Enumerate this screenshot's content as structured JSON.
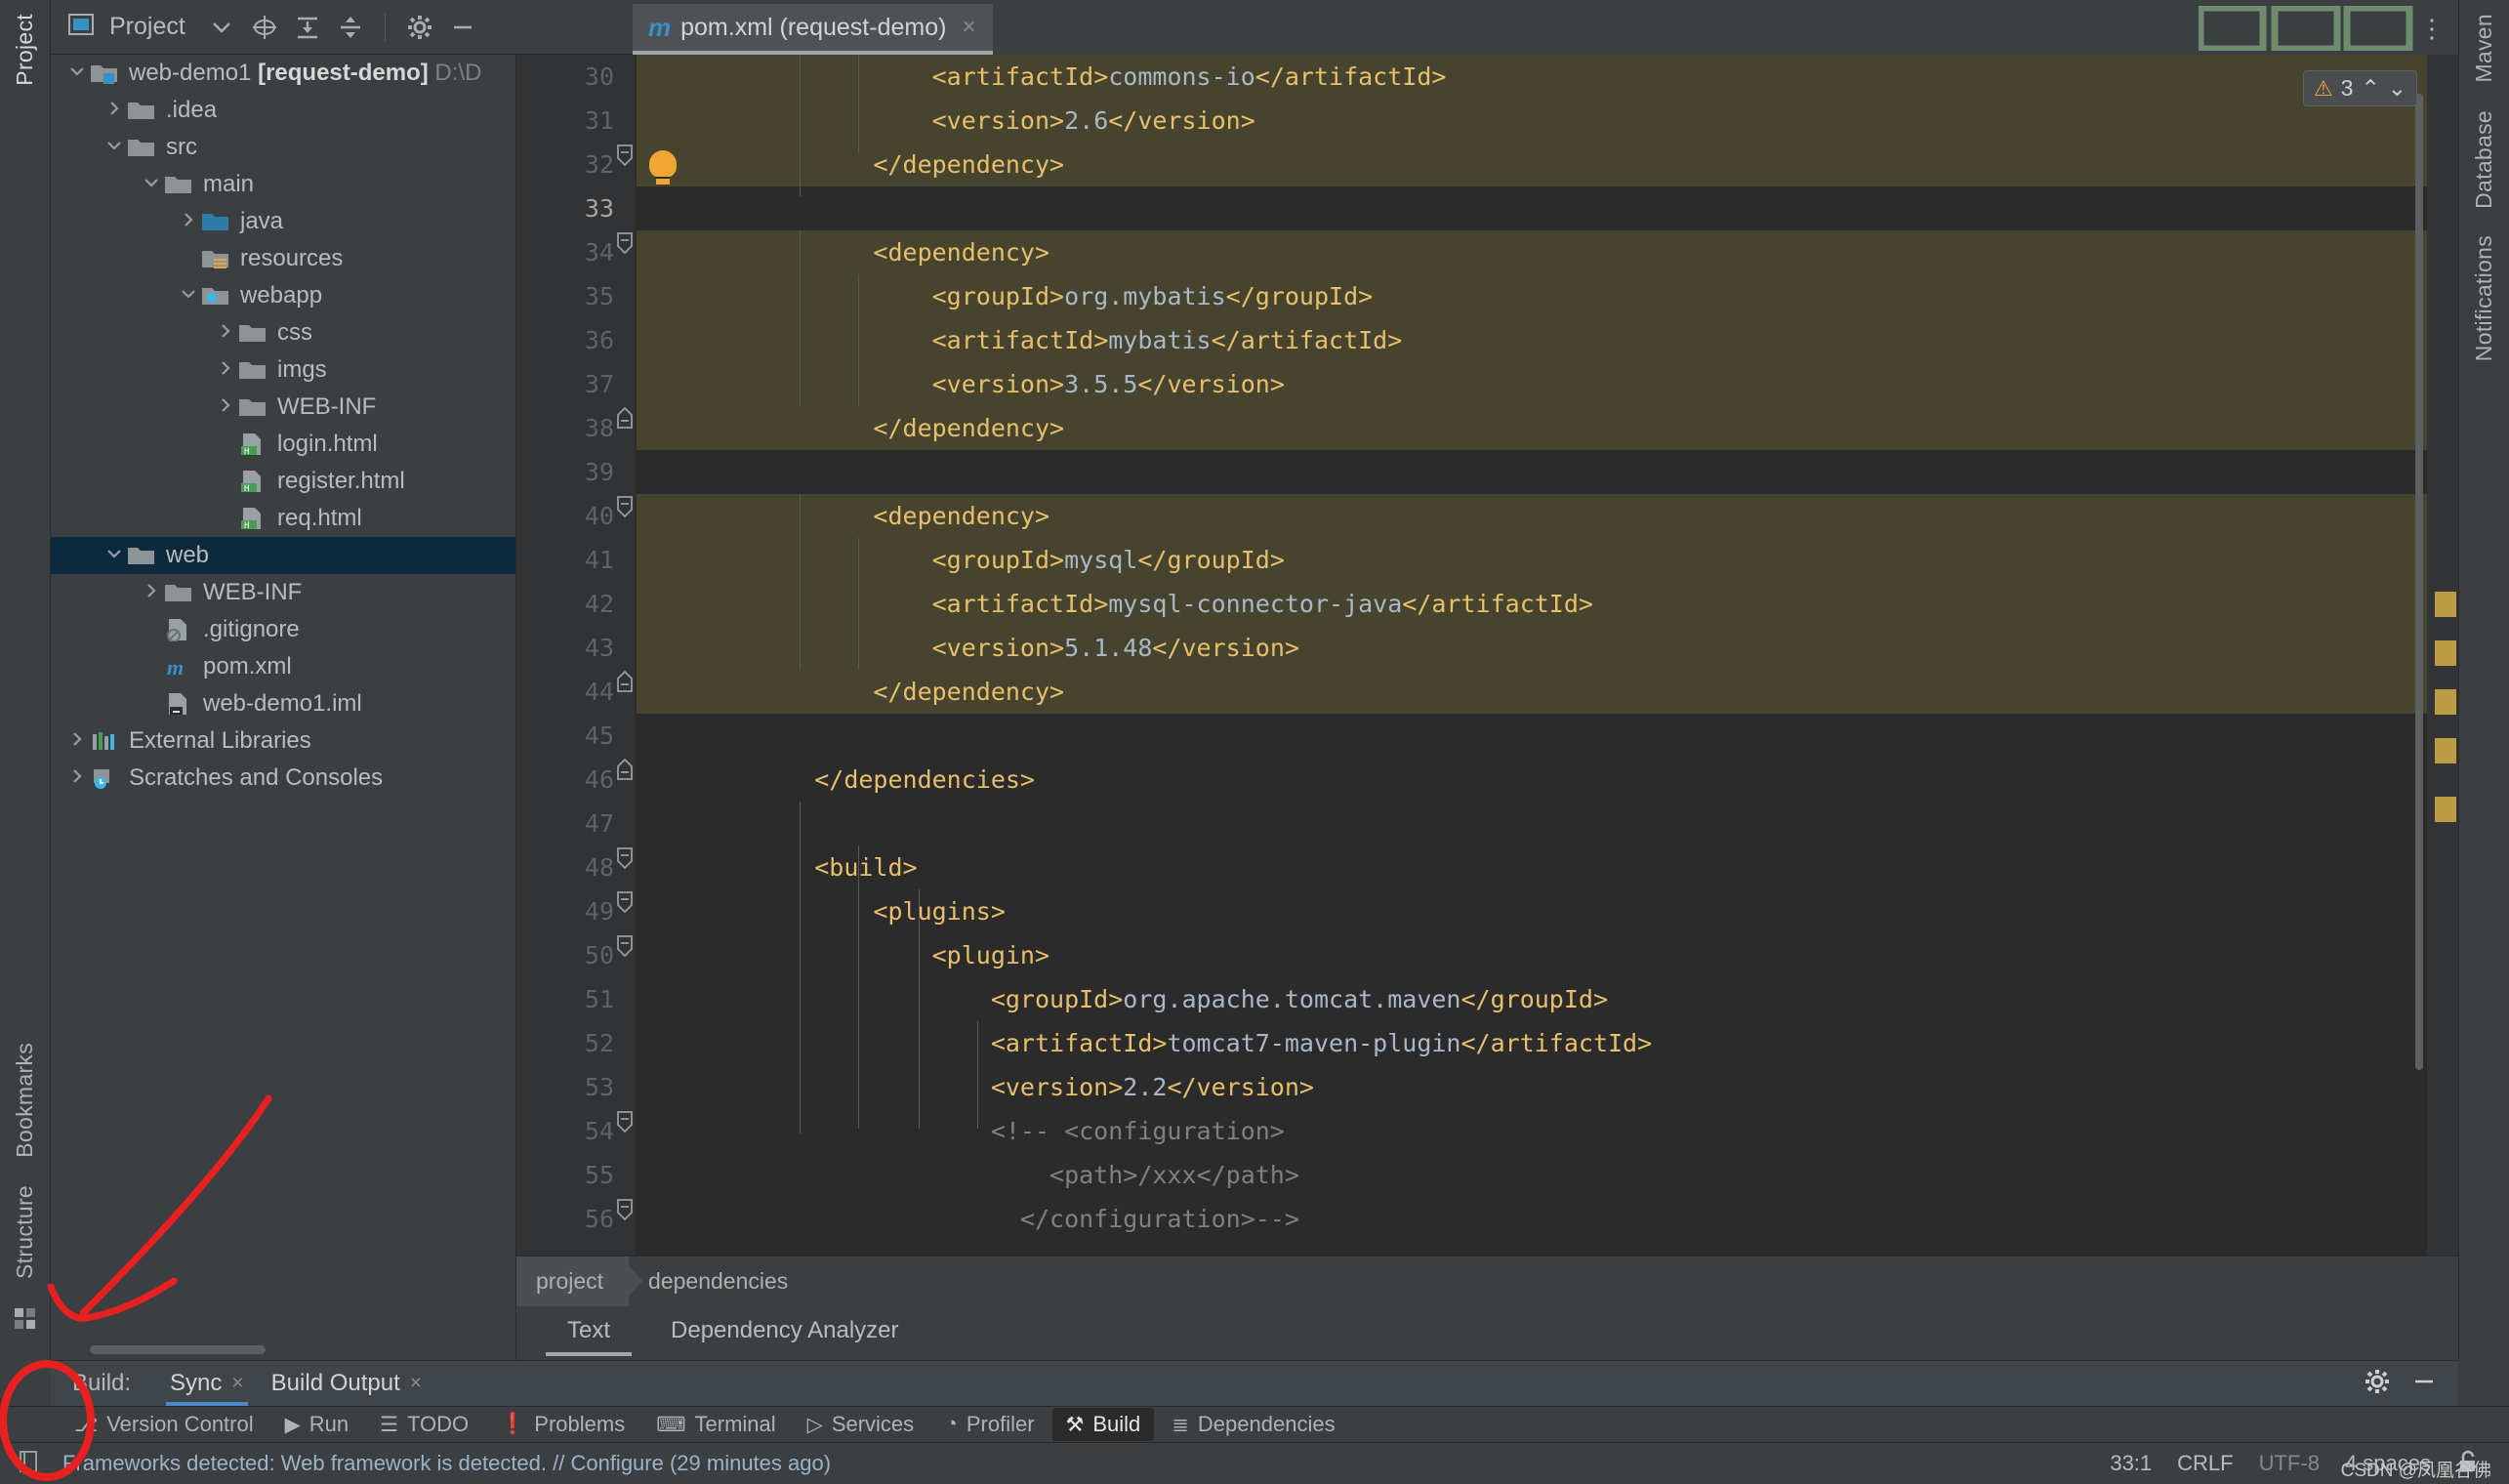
{
  "window": {
    "left_tool_tabs": [
      "Project",
      "Bookmarks",
      "Structure"
    ],
    "right_tool_tabs": [
      "Maven",
      "Database",
      "Notifications"
    ]
  },
  "project_toolbar": {
    "title": "Project",
    "dropdown_icon": "chevron-down-icon",
    "buttons": [
      {
        "name": "locate-icon",
        "glyph": "⊕"
      },
      {
        "name": "expand-all-icon",
        "glyph": "≡"
      },
      {
        "name": "collapse-all-icon",
        "glyph": "≡"
      },
      {
        "name": "settings-gear-icon",
        "glyph": "⚙"
      },
      {
        "name": "hide-panel-icon",
        "glyph": "—"
      }
    ]
  },
  "editor_tabs": [
    {
      "label": "pom.xml (request-demo)",
      "icon": "maven-m-icon",
      "close": "×",
      "active": true
    }
  ],
  "tree": [
    {
      "depth": 0,
      "arrow": "down",
      "icon": "module-folder",
      "label": "web-demo1 ",
      "bold": "[request-demo]",
      "dim": " D:\\D",
      "selected": false
    },
    {
      "depth": 1,
      "arrow": "right",
      "icon": "folder",
      "label": ".idea",
      "selected": false
    },
    {
      "depth": 1,
      "arrow": "down",
      "icon": "folder",
      "label": "src",
      "selected": false
    },
    {
      "depth": 2,
      "arrow": "down",
      "icon": "folder",
      "label": "main",
      "selected": false
    },
    {
      "depth": 3,
      "arrow": "right",
      "icon": "source-folder",
      "label": "java",
      "selected": false
    },
    {
      "depth": 3,
      "arrow": "blank",
      "icon": "resource-folder",
      "label": "resources",
      "selected": false
    },
    {
      "depth": 3,
      "arrow": "down",
      "icon": "webapp-folder",
      "label": "webapp",
      "selected": false
    },
    {
      "depth": 4,
      "arrow": "right",
      "icon": "folder",
      "label": "css",
      "selected": false
    },
    {
      "depth": 4,
      "arrow": "right",
      "icon": "folder",
      "label": "imgs",
      "selected": false
    },
    {
      "depth": 4,
      "arrow": "right",
      "icon": "folder",
      "label": "WEB-INF",
      "selected": false
    },
    {
      "depth": 4,
      "arrow": "blank",
      "icon": "html-file",
      "label": "login.html",
      "selected": false
    },
    {
      "depth": 4,
      "arrow": "blank",
      "icon": "html-file",
      "label": "register.html",
      "selected": false
    },
    {
      "depth": 4,
      "arrow": "blank",
      "icon": "html-file",
      "label": "req.html",
      "selected": false
    },
    {
      "depth": 1,
      "arrow": "down",
      "icon": "folder",
      "label": "web",
      "selected": true
    },
    {
      "depth": 2,
      "arrow": "right",
      "icon": "folder",
      "label": "WEB-INF",
      "selected": false
    },
    {
      "depth": 2,
      "arrow": "blank",
      "icon": "gitignore-file",
      "label": ".gitignore",
      "selected": false
    },
    {
      "depth": 2,
      "arrow": "blank",
      "icon": "maven-m-icon",
      "label": "pom.xml",
      "selected": false
    },
    {
      "depth": 2,
      "arrow": "blank",
      "icon": "iml-file",
      "label": "web-demo1.iml",
      "selected": false
    },
    {
      "depth": 0,
      "arrow": "right",
      "icon": "libraries-icon",
      "label": "External Libraries",
      "selected": false
    },
    {
      "depth": 0,
      "arrow": "right",
      "icon": "scratches-icon",
      "label": "Scratches and Consoles",
      "selected": false
    }
  ],
  "code": {
    "language": "xml",
    "lines": [
      {
        "n": 30,
        "text": "            <artifactId>commons-io</artifactId>",
        "hl": true,
        "fold": "",
        "bulb": false
      },
      {
        "n": 31,
        "text": "            <version>2.6</version>",
        "hl": true,
        "fold": "",
        "bulb": false
      },
      {
        "n": 32,
        "text": "        </dependency>",
        "hl": true,
        "fold": "minus",
        "bulb": true
      },
      {
        "n": 33,
        "text": "",
        "hl": false,
        "fold": "",
        "bulb": false,
        "current": true
      },
      {
        "n": 34,
        "text": "        <dependency>",
        "hl": true,
        "fold": "minus",
        "bulb": false
      },
      {
        "n": 35,
        "text": "            <groupId>org.mybatis</groupId>",
        "hl": true,
        "fold": "",
        "bulb": false
      },
      {
        "n": 36,
        "text": "            <artifactId>mybatis</artifactId>",
        "hl": true,
        "fold": "",
        "bulb": false
      },
      {
        "n": 37,
        "text": "            <version>3.5.5</version>",
        "hl": true,
        "fold": "",
        "bulb": false
      },
      {
        "n": 38,
        "text": "        </dependency>",
        "hl": true,
        "fold": "up",
        "bulb": false
      },
      {
        "n": 39,
        "text": "",
        "hl": false,
        "fold": "",
        "bulb": false
      },
      {
        "n": 40,
        "text": "        <dependency>",
        "hl": true,
        "fold": "minus",
        "bulb": false
      },
      {
        "n": 41,
        "text": "            <groupId>mysql</groupId>",
        "hl": true,
        "fold": "",
        "bulb": false
      },
      {
        "n": 42,
        "text": "            <artifactId>mysql-connector-java</artifactId>",
        "hl": true,
        "fold": "",
        "bulb": false
      },
      {
        "n": 43,
        "text": "            <version>5.1.48</version>",
        "hl": true,
        "fold": "",
        "bulb": false
      },
      {
        "n": 44,
        "text": "        </dependency>",
        "hl": true,
        "fold": "up",
        "bulb": false
      },
      {
        "n": 45,
        "text": "",
        "hl": false,
        "fold": "",
        "bulb": false
      },
      {
        "n": 46,
        "text": "    </dependencies>",
        "hl": false,
        "fold": "up",
        "bulb": false
      },
      {
        "n": 47,
        "text": "",
        "hl": false,
        "fold": "",
        "bulb": false
      },
      {
        "n": 48,
        "text": "    <build>",
        "hl": false,
        "fold": "minus",
        "bulb": false
      },
      {
        "n": 49,
        "text": "        <plugins>",
        "hl": false,
        "fold": "minus",
        "bulb": false
      },
      {
        "n": 50,
        "text": "            <plugin>",
        "hl": false,
        "fold": "minus",
        "bulb": false
      },
      {
        "n": 51,
        "text": "                <groupId>org.apache.tomcat.maven</groupId>",
        "hl": false,
        "fold": "",
        "bulb": false
      },
      {
        "n": 52,
        "text": "                <artifactId>tomcat7-maven-plugin</artifactId>",
        "hl": false,
        "fold": "",
        "bulb": false
      },
      {
        "n": 53,
        "text": "                <version>2.2</version>",
        "hl": false,
        "fold": "",
        "bulb": false
      },
      {
        "n": 54,
        "text": "                <!-- <configuration>",
        "hl": false,
        "fold": "minus",
        "bulb": false,
        "comment": true
      },
      {
        "n": 55,
        "text": "                    <path>/xxx</path>",
        "hl": false,
        "fold": "",
        "bulb": false,
        "comment": true
      },
      {
        "n": 56,
        "text": "                  </configuration>-->",
        "hl": false,
        "fold": "minus",
        "bulb": false,
        "comment": true
      }
    ],
    "inspection_widget": {
      "icon": "warning-triangle-icon",
      "count": "3",
      "up": "⌃",
      "down": "⌄"
    }
  },
  "breadcrumbs": [
    {
      "label": "project",
      "active": true
    },
    {
      "label": "dependencies",
      "active": false
    }
  ],
  "editor_subtabs": [
    {
      "label": "Text",
      "selected": true
    },
    {
      "label": "Dependency Analyzer",
      "selected": false
    }
  ],
  "build_window": {
    "label": "Build:",
    "tabs": [
      {
        "label": "Sync",
        "close": "×",
        "selected": true
      },
      {
        "label": "Build Output",
        "close": "×",
        "selected": false
      }
    ],
    "settings_icon": "gear-icon",
    "minimize_icon": "minimize-icon"
  },
  "bottom_tabs": [
    {
      "label": "Version Control",
      "icon": "vcs-icon",
      "glyph": "⎇",
      "selected": false
    },
    {
      "label": "Run",
      "icon": "run-icon",
      "glyph": "▶",
      "selected": false
    },
    {
      "label": "TODO",
      "icon": "todo-icon",
      "glyph": "☰",
      "selected": false
    },
    {
      "label": "Problems",
      "icon": "problems-icon",
      "glyph": "❗",
      "selected": false
    },
    {
      "label": "Terminal",
      "icon": "terminal-icon",
      "glyph": "⌨",
      "selected": false
    },
    {
      "label": "Services",
      "icon": "services-icon",
      "glyph": "▷",
      "selected": false
    },
    {
      "label": "Profiler",
      "icon": "profiler-icon",
      "glyph": "◔",
      "selected": false
    },
    {
      "label": "Build",
      "icon": "build-hammer-icon",
      "glyph": "⚒",
      "selected": true
    },
    {
      "label": "Dependencies",
      "icon": "dependencies-icon",
      "glyph": "≣",
      "selected": false
    }
  ],
  "status_bar": {
    "icon": "notification-icon",
    "message": "Frameworks detected: Web framework is detected. // Configure (29 minutes ago)",
    "caret_position": "33:1",
    "line_separator": "CRLF",
    "encoding": "UTF-8",
    "indent": "4 spaces",
    "lock_icon": "unlocked-icon"
  },
  "watermark": "CSDN @凤凰谷佛",
  "colors": {
    "background": "#3c3f41",
    "editor_background": "#2b2b2b",
    "selection": "#0d293e",
    "tag": "#e8bf6a",
    "value": "#a9b7c6",
    "comment": "#808080",
    "highlight_band": "#5c5a32",
    "accent_blue": "#4a88c7",
    "annotation_red": "#e8201f"
  }
}
